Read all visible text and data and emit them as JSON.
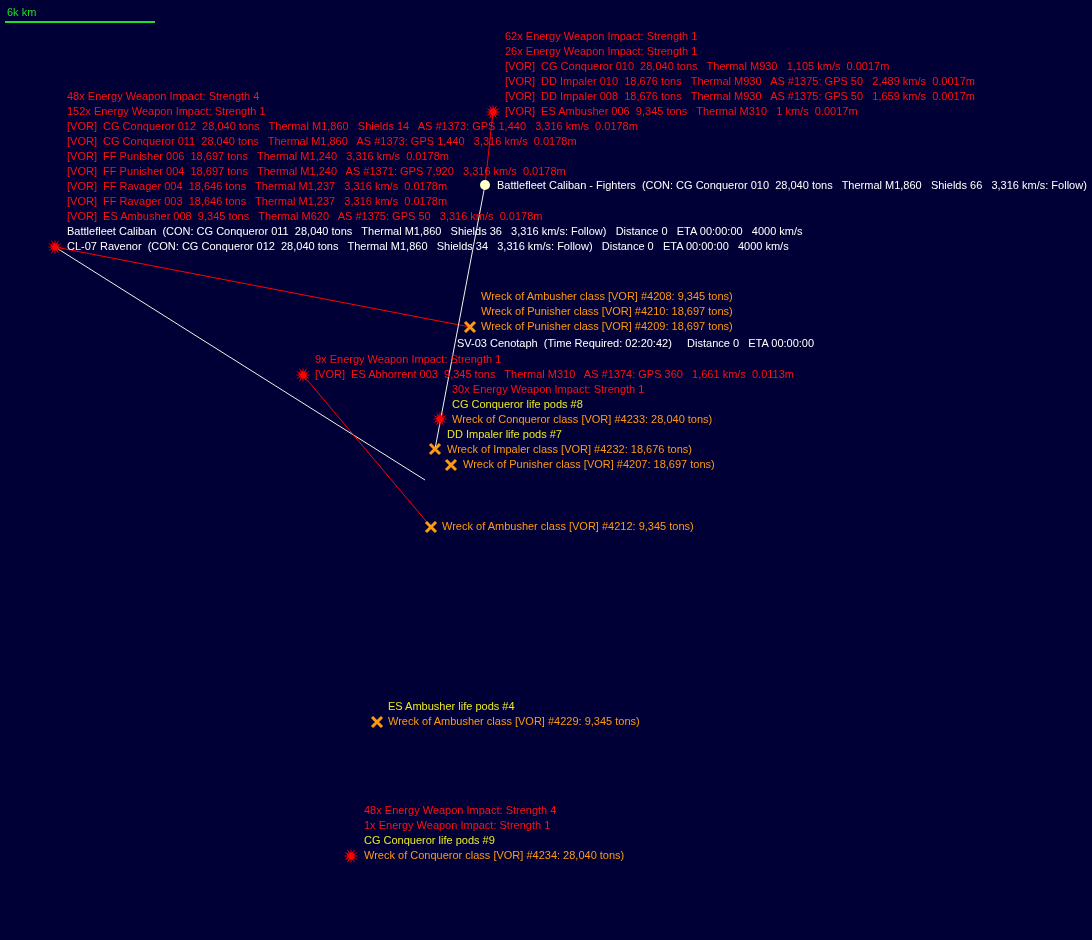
{
  "scale_bar": {
    "label": "6k km"
  },
  "contacts": [
    {
      "kind": "impact",
      "labels": [
        {
          "kind": "impact",
          "text": "62x Energy Weapon Impact: Strength 1"
        },
        {
          "kind": "impact",
          "text": "26x Energy Weapon Impact: Strength 1"
        },
        {
          "kind": "contact",
          "text": "[VOR]  CG Conqueror 010  28,040 tons   Thermal M930   1,105 km/s  0.0017m"
        },
        {
          "kind": "contact",
          "text": "[VOR]  DD Impaler 010  18,676 tons   Thermal M930   AS #1375: GPS 50   2,489 km/s  0.0017m"
        },
        {
          "kind": "contact",
          "text": "[VOR]  DD Impaler 008  18,676 tons   Thermal M930   AS #1375: GPS 50   1,659 km/s  0.0017m"
        },
        {
          "kind": "contact",
          "text": "[VOR]  ES Ambusher 006  9,345 tons   Thermal M310   1 km/s  0.0017m"
        }
      ]
    },
    {
      "kind": "impact",
      "labels": [
        {
          "kind": "impact",
          "text": "48x Energy Weapon Impact: Strength 4"
        },
        {
          "kind": "impact",
          "text": "152x Energy Weapon Impact: Strength 1"
        },
        {
          "kind": "contact",
          "text": "[VOR]  CG Conqueror 012  28,040 tons   Thermal M1,860   Shields 14   AS #1373: GPS 1,440   3,316 km/s  0.0178m"
        },
        {
          "kind": "contact",
          "text": "[VOR]  CG Conqueror 011  28,040 tons   Thermal M1,860   AS #1373: GPS 1,440   3,316 km/s  0.0178m"
        },
        {
          "kind": "contact",
          "text": "[VOR]  FF Punisher 006  18,697 tons   Thermal M1,240   3,316 km/s  0.0178m"
        },
        {
          "kind": "contact",
          "text": "[VOR]  FF Punisher 004  18,697 tons   Thermal M1,240   AS #1371: GPS 7,920   3,316 km/s  0.0178m"
        },
        {
          "kind": "contact",
          "text": "[VOR]  FF Ravager 004  18,646 tons   Thermal M1,237   3,316 km/s  0.0178m"
        },
        {
          "kind": "contact",
          "text": "[VOR]  FF Ravager 003  18,646 tons   Thermal M1,237   3,316 km/s  0.0178m"
        },
        {
          "kind": "contact",
          "text": "[VOR]  ES Ambusher 008  9,345 tons   Thermal M620   AS #1375: GPS 50   3,316 km/s  0.0178m"
        },
        {
          "kind": "fleet",
          "text": "Battlefleet Caliban  (CON: CG Conqueror 011  28,040 tons   Thermal M1,860   Shields 36   3,316 km/s: Follow)   Distance 0   ETA 00:00:00   4000 km/s"
        },
        {
          "kind": "fleet",
          "text": "CL-07 Ravenor  (CON: CG Conqueror 012  28,040 tons   Thermal M1,860   Shields 34   3,316 km/s: Follow)   Distance 0   ETA 00:00:00   4000 km/s"
        }
      ]
    },
    {
      "kind": "fleet",
      "labels": [
        {
          "kind": "fleet",
          "text": "Battlefleet Caliban - Fighters  (CON: CG Conqueror 010  28,040 tons   Thermal M1,860   Shields 66   3,316 km/s: Follow)"
        }
      ]
    },
    {
      "kind": "wreck",
      "labels": [
        {
          "kind": "wreck",
          "text": "Wreck of Ambusher class [VOR] #4208: 9,345 tons)"
        },
        {
          "kind": "wreck",
          "text": "Wreck of Punisher class [VOR] #4210: 18,697 tons)"
        },
        {
          "kind": "wreck",
          "text": "Wreck of Punisher class [VOR] #4209: 18,697 tons)"
        }
      ]
    },
    {
      "labels": [
        {
          "kind": "fleet",
          "text": "SV-03 Cenotaph  (Time Required: 02:20:42)     Distance 0   ETA 00:00:00"
        }
      ]
    },
    {
      "kind": "impact",
      "labels": [
        {
          "kind": "impact",
          "text": "9x Energy Weapon Impact: Strength 1"
        },
        {
          "kind": "contact",
          "text": "[VOR]  ES Abhorrent 003  9,345 tons   Thermal M310   AS #1374: GPS 360   1,661 km/s  0.0113m"
        }
      ]
    },
    {
      "kind": "impact",
      "labels": [
        {
          "kind": "impact",
          "text": "30x Energy Weapon Impact: Strength 1"
        },
        {
          "kind": "pods",
          "text": "CG Conqueror life pods #8"
        },
        {
          "kind": "wreck",
          "text": "Wreck of Conqueror class [VOR] #4233: 28,040 tons)"
        }
      ]
    },
    {
      "kind": "wreck",
      "labels": [
        {
          "kind": "pods",
          "text": "DD Impaler life pods #7"
        },
        {
          "kind": "wreck",
          "text": "Wreck of Impaler class [VOR] #4232: 18,676 tons)"
        }
      ]
    },
    {
      "kind": "wreck",
      "labels": [
        {
          "kind": "wreck",
          "text": "Wreck of Punisher class [VOR] #4207: 18,697 tons)"
        }
      ]
    },
    {
      "kind": "wreck",
      "labels": [
        {
          "kind": "wreck",
          "text": "Wreck of Ambusher class [VOR] #4212: 9,345 tons)"
        }
      ]
    },
    {
      "kind": "wreck",
      "labels": [
        {
          "kind": "pods",
          "text": "ES Ambusher life pods #4"
        },
        {
          "kind": "wreck",
          "text": "Wreck of Ambusher class [VOR] #4229: 9,345 tons)"
        }
      ]
    },
    {
      "kind": "impact",
      "labels": [
        {
          "kind": "impact",
          "text": "48x Energy Weapon Impact: Strength 4"
        },
        {
          "kind": "impact",
          "text": "1x Energy Weapon Impact: Strength 1"
        },
        {
          "kind": "pods",
          "text": "CG Conqueror life pods #9"
        },
        {
          "kind": "wreck",
          "text": "Wreck of Conqueror class [VOR] #4234: 28,040 tons)"
        }
      ]
    }
  ]
}
